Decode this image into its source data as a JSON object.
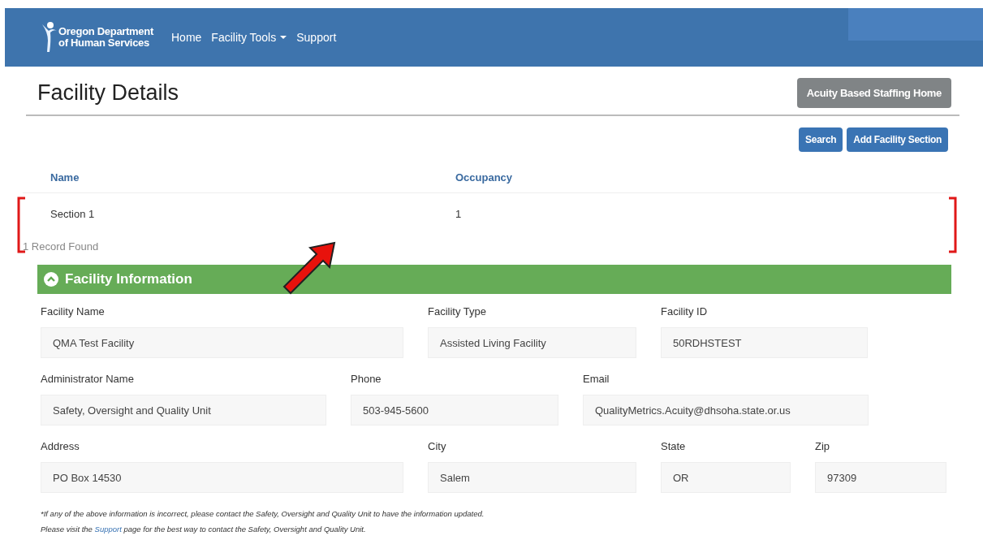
{
  "header": {
    "logo_lines": [
      "Oregon Department",
      "of Human Services"
    ],
    "nav": [
      {
        "label": "Home",
        "dropdown": false
      },
      {
        "label": "Facility Tools",
        "dropdown": true
      },
      {
        "label": "Support",
        "dropdown": false
      }
    ]
  },
  "page": {
    "title": "Facility Details",
    "home_button": "Acuity Based Staffing Home"
  },
  "actions": [
    "Search",
    "Add Facility Section"
  ],
  "table": {
    "columns": [
      "Name",
      "Occupancy"
    ],
    "rows": [
      [
        "Section 1",
        "1"
      ]
    ],
    "count": "1 Record Found"
  },
  "panel": {
    "title": "Facility Information",
    "expanded": true,
    "rows": [
      [
        {
          "label": "Facility Name",
          "value": "QMA Test Facility"
        },
        {
          "label": "Facility Type",
          "value": "Assisted Living Facility"
        },
        {
          "label": "Facility ID",
          "value": "50RDHSTEST"
        }
      ],
      [
        {
          "label": "Administrator Name",
          "value": "Safety, Oversight and Quality Unit"
        },
        {
          "label": "Phone",
          "value": "503-945-5600"
        },
        {
          "label": "Email",
          "value": "QualityMetrics.Acuity@dhsoha.state.or.us"
        }
      ],
      [
        {
          "label": "Address",
          "value": "PO Box 14530"
        },
        {
          "label": "City",
          "value": "Salem"
        },
        {
          "label": "State",
          "value": "OR"
        },
        {
          "label": "Zip",
          "value": "97309"
        }
      ]
    ]
  },
  "note": {
    "line_1": "*If any of the above information is incorrect, please contact the Safety, Oversight and Quality Unit to have the information updated.",
    "line_2_before": "Please visit the",
    "line_2_link": "Support",
    "line_2_after": "page for the best way to contact the Safety, Oversight and Quality Unit."
  }
}
